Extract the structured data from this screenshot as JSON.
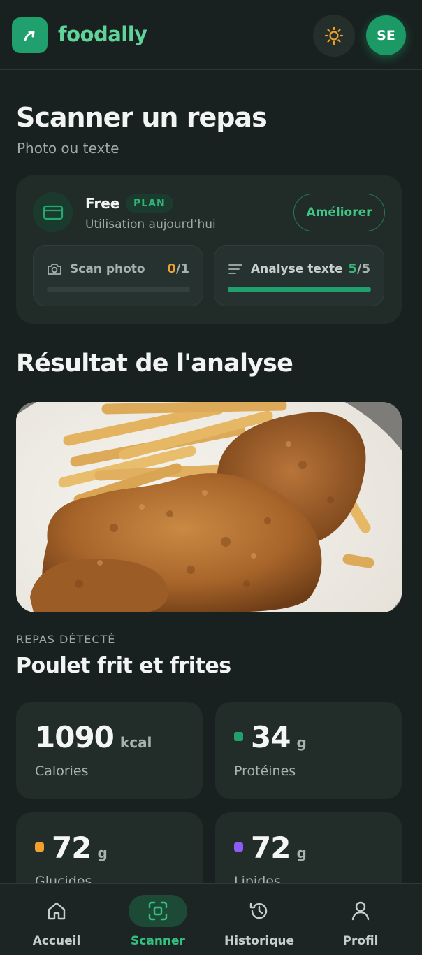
{
  "header": {
    "brand": "foodally",
    "avatar_initials": "SE",
    "theme_icon": "sun-icon",
    "accent": "#20a06c"
  },
  "page": {
    "title": "Scanner un repas",
    "subtitle": "Photo ou texte"
  },
  "plan": {
    "name": "Free",
    "badge": "PLAN",
    "usage_label": "Utilisation aujourd’hui",
    "upgrade_label": "Améliorer",
    "quotas": [
      {
        "label": "Scan photo",
        "used": "0",
        "limit": "/1",
        "progress": 0,
        "icon": "camera-icon"
      },
      {
        "label": "Analyse texte",
        "used": "5",
        "limit": "/5",
        "progress": 1,
        "icon": "text-lines-icon"
      }
    ]
  },
  "result": {
    "title": "Résultat de l'analyse",
    "photo_alt": "Poulet frit et frites",
    "detected_label": "REPAS DÉTECTÉ",
    "meal_name": "Poulet frit et frites",
    "stats": [
      {
        "value": "1090",
        "unit": "kcal",
        "label": "Calories",
        "dot_color": ""
      },
      {
        "value": "34",
        "unit": "g",
        "label": "Protéines",
        "dot_color": "#20a06c"
      },
      {
        "value": "72",
        "unit": "g",
        "label": "Glucides",
        "dot_color": "#f0a12d"
      },
      {
        "value": "72",
        "unit": "g",
        "label": "Lipides",
        "dot_color": "#8b5cf6"
      }
    ]
  },
  "nav": {
    "active": "Scanner",
    "items": [
      {
        "label": "Accueil",
        "icon": "home-icon"
      },
      {
        "label": "Scanner",
        "icon": "scan-icon"
      },
      {
        "label": "Historique",
        "icon": "history-icon"
      },
      {
        "label": "Profil",
        "icon": "user-icon"
      }
    ]
  }
}
